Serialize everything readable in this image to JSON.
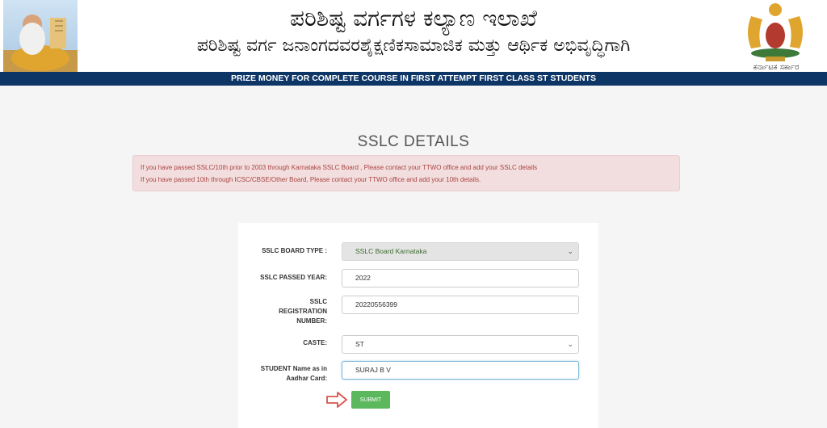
{
  "header": {
    "title_kannada": "ಪರಿಶಿಷ್ಟ ವರ್ಗಗಳ ಕಲ್ಯಾಣ ಇಲಾಖೆ",
    "subtitle_kannada": "ಪರಿಶಿಷ್ಟ ವರ್ಗ ಜನಾಂಗದವರಶೈಕ್ಷಣಿಕಸಾಮಾಜಿಕ ಮತ್ತು ಆರ್ಥಿಕ ಅಭಿವೃದ್ಧಿಗಾಗಿ",
    "emblem_label": "ಕರ್ನಾಟಕ ಸರ್ಕಾರ",
    "band_text": "PRIZE MONEY FOR COMPLETE COURSE IN FIRST ATTEMPT FIRST CLASS ST STUDENTS"
  },
  "page": {
    "heading": "SSLC DETAILS",
    "alert_lines": [
      "If you have passed SSLC/10th prior to 2003 through Karnataka SSLC Board , Please contact your TTWO office and add your SSLC details",
      "If you have passed 10th through ICSC/CBSE/Other Board, Please contact your TTWO office and add your 10th details."
    ]
  },
  "form": {
    "board_type": {
      "label": "SSLC BOARD TYPE :",
      "value": "SSLC Board Karnataka"
    },
    "passed_year": {
      "label": "SSLC PASSED YEAR:",
      "value": "2022"
    },
    "registration": {
      "label_lines": [
        "SSLC",
        "REGISTRATION",
        "NUMBER:"
      ],
      "value": "20220556399"
    },
    "caste": {
      "label": "CASTE:",
      "value": "ST"
    },
    "student_name": {
      "label_lines": [
        "STUDENT Name as in",
        "Aadhar Card:"
      ],
      "value": "SURAJ B V"
    },
    "submit_label": "SUBMIT"
  },
  "colors": {
    "band": "#0d3566",
    "submit": "#5cb85c",
    "alert_bg": "#f2dede",
    "alert_text": "#a94442",
    "arrow": "#d9534f"
  },
  "icons": {
    "select_caret": "chevron-down-icon",
    "pointer": "arrow-right-icon"
  }
}
